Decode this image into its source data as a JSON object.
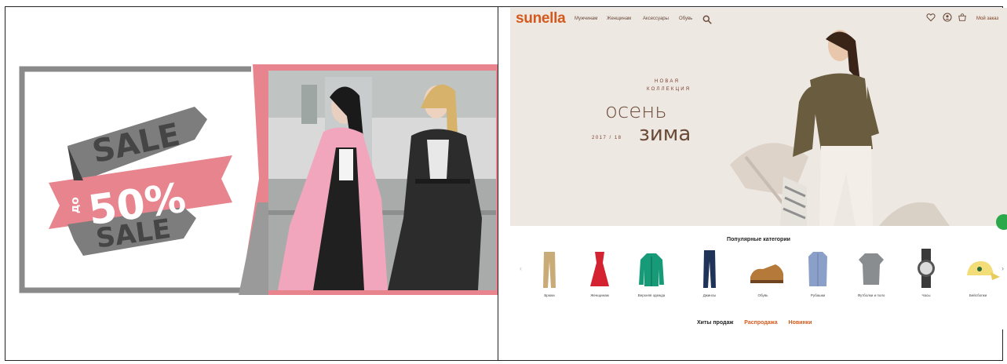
{
  "banner_left": {
    "sale_top": "SALE",
    "prefix": "до",
    "discount": "50%",
    "sale_bottom": "SALE",
    "colors": {
      "pink": "#e8848d",
      "gray": "#7d7d7d",
      "dark": "#3f3f3f"
    }
  },
  "site": {
    "logo": "sunella",
    "nav": [
      "Мужчинам",
      "Женщинам",
      "Аксессуары",
      "Обувь"
    ],
    "order_link": "Мой заказ",
    "icons": [
      "search-icon",
      "heart-icon",
      "account-icon",
      "bag-icon"
    ],
    "accent": "#d35a1c"
  },
  "hero": {
    "label_line1": "НОВАЯ",
    "label_line2": "КОЛЛЕКЦИЯ",
    "season_1": "осень",
    "season_2": "зима",
    "year": "2017 / 18"
  },
  "categories": {
    "title": "Популярные категории",
    "items": [
      {
        "label": "Брюки",
        "icon": "trousers-icon"
      },
      {
        "label": "Женщинам",
        "icon": "dress-icon"
      },
      {
        "label": "Верхняя одежда",
        "icon": "jacket-icon"
      },
      {
        "label": "Джинсы",
        "icon": "jeans-icon"
      },
      {
        "label": "Обувь",
        "icon": "shoe-icon"
      },
      {
        "label": "Рубашки",
        "icon": "shirt-icon"
      },
      {
        "label": "Футболки и поло",
        "icon": "tshirt-icon"
      },
      {
        "label": "Часы",
        "icon": "watch-icon"
      },
      {
        "label": "Бейсболки",
        "icon": "cap-icon"
      }
    ]
  },
  "tabs": [
    "Хиты продаж",
    "Распродажа",
    "Новинки"
  ]
}
